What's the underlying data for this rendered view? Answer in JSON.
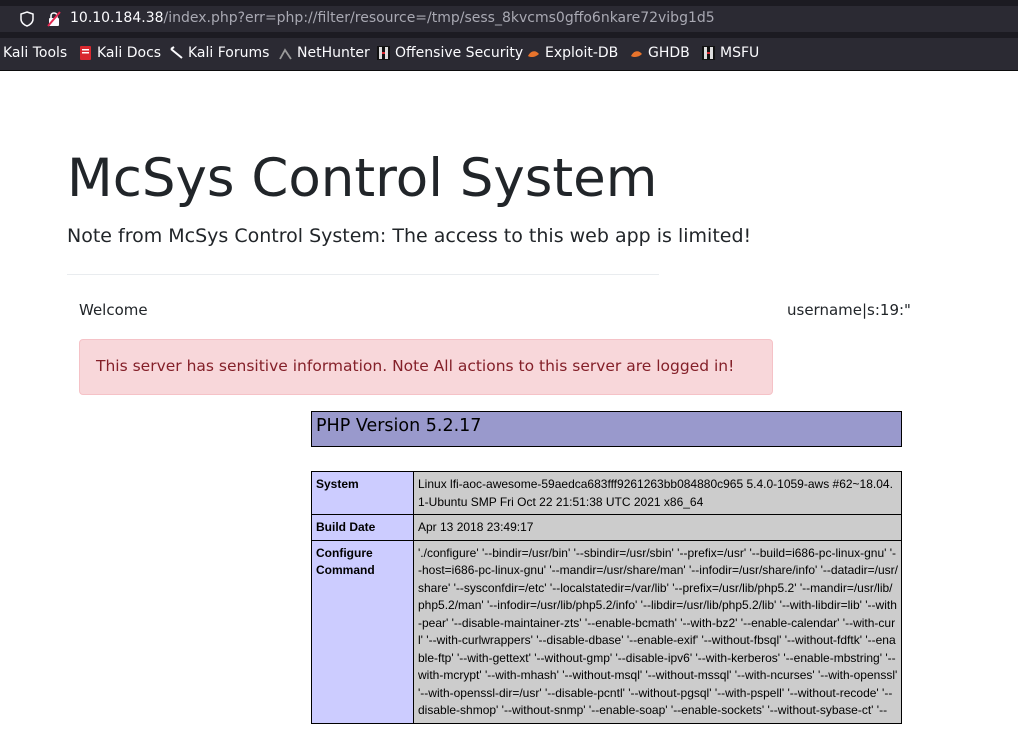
{
  "browser": {
    "url_host": "10.10.184.38",
    "url_path": "/index.php?err=php://filter/resource=/tmp/sess_8kvcms0gffo6nkare72vibg1d5",
    "bookmarks": [
      {
        "label": "Kali Tools",
        "icon": "kali-icon"
      },
      {
        "label": "Kali Docs",
        "icon": "kali-docs-icon"
      },
      {
        "label": "Kali Forums",
        "icon": "kali-forums-icon"
      },
      {
        "label": "NetHunter",
        "icon": "nethunter-icon"
      },
      {
        "label": "Offensive Security",
        "icon": "offsec-icon"
      },
      {
        "label": "Exploit-DB",
        "icon": "exploitdb-icon"
      },
      {
        "label": "GHDB",
        "icon": "ghdb-icon"
      },
      {
        "label": "MSFU",
        "icon": "msfu-icon"
      }
    ]
  },
  "page": {
    "title": "McSys Control System",
    "note": "Note from McSys Control System: The access to this web app is limited!",
    "welcome": "Welcome",
    "username": "username|s:19:\"",
    "alert": "This server has sensitive information. Note All actions to this server are logged in!"
  },
  "phpinfo": {
    "version": "PHP Version 5.2.17",
    "rows": [
      {
        "key": "System",
        "value": "Linux lfi-aoc-awesome-59aedca683fff9261263bb084880c965 5.4.0-1059-aws #62~18.04.1-Ubuntu SMP Fri Oct 22 21:51:38 UTC 2021 x86_64"
      },
      {
        "key": "Build Date",
        "value": "Apr 13 2018 23:49:17"
      },
      {
        "key": "Configure Command",
        "value": "'./configure' '--bindir=/usr/bin' '--sbindir=/usr/sbin' '--prefix=/usr' '--build=i686-pc-linux-gnu' '--host=i686-pc-linux-gnu' '--mandir=/usr/share/man' '--infodir=/usr/share/info' '--datadir=/usr/share' '--sysconfdir=/etc' '--localstatedir=/var/lib' '--prefix=/usr/lib/php5.2' '--mandir=/usr/lib/php5.2/man' '--infodir=/usr/lib/php5.2/info' '--libdir=/usr/lib/php5.2/lib' '--with-libdir=lib' '--with-pear' '--disable-maintainer-zts' '--enable-bcmath' '--with-bz2' '--enable-calendar' '--with-curl' '--with-curlwrappers' '--disable-dbase' '--enable-exif' '--without-fbsql' '--without-fdftk' '--enable-ftp' '--with-gettext' '--without-gmp' '--disable-ipv6' '--with-kerberos' '--enable-mbstring' '--with-mcrypt' '--with-mhash' '--without-msql' '--without-mssql' '--with-ncurses' '--with-openssl' '--with-openssl-dir=/usr' '--disable-pcntl' '--without-pgsql' '--with-pspell' '--without-recode' '--disable-shmop' '--without-snmp' '--enable-soap' '--enable-sockets' '--without-sybase-ct' '--"
      }
    ]
  }
}
